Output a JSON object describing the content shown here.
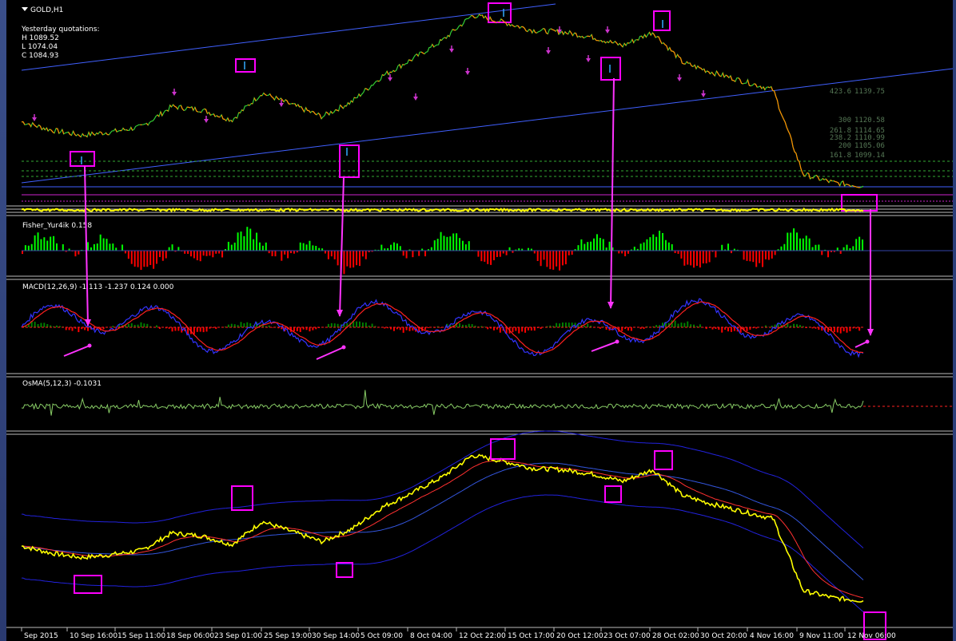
{
  "window": {
    "symbol_label": "GOLD,H1",
    "menu_icon": "triangle-down-icon"
  },
  "quotes": {
    "heading": "Yesterday quotations:",
    "high": "H 1089.52",
    "low": "L 1074.04",
    "close": "C 1084.93"
  },
  "fib_levels": [
    {
      "ratio": "423.6",
      "price": "1139.75"
    },
    {
      "ratio": "300",
      "price": "1120.58"
    },
    {
      "ratio": "261.8",
      "price": "1114.65"
    },
    {
      "ratio": "238.2",
      "price": "1110.99"
    },
    {
      "ratio": "200",
      "price": "1105.06"
    },
    {
      "ratio": "161.8",
      "price": "1099.14"
    }
  ],
  "indicators": {
    "fisher": "Fisher_Yur4ik 0.158",
    "macd": "MACD(12,26,9) -1.113 -1.237 0.124 0.000",
    "osma": "OsMA(5,12,3) -0.1031"
  },
  "colors": {
    "price_bull": "#33cc33",
    "price_bear": "#ff8800",
    "trendline": "#4060ff",
    "box": "#ff00ff",
    "fisher_pos": "#00ff00",
    "fisher_neg": "#ff0000",
    "macd_main": "#3333ff",
    "macd_signal": "#ff2020",
    "macd_hist_pos": "#008000",
    "macd_hist_neg": "#ff0000",
    "bands": "#2222dd",
    "yellow_line": "#ffff00"
  },
  "chart_data": {
    "type": "line",
    "title": "GOLD,H1",
    "x_tick_labels": [
      "Sep 2015",
      "10 Sep 16:00",
      "15 Sep 11:00",
      "18 Sep 06:00",
      "23 Sep 01:00",
      "25 Sep 19:00",
      "30 Sep 14:00",
      "5 Oct 09:00",
      "8 Oct 04:00",
      "12 Oct 22:00",
      "15 Oct 17:00",
      "20 Oct 12:00",
      "23 Oct 07:00",
      "28 Oct 02:00",
      "30 Oct 20:00",
      "4 Nov 16:00",
      "9 Nov 11:00",
      "12 Nov 06:00"
    ],
    "approx_price_path": [
      1121,
      1116,
      1113,
      1115,
      1118,
      1130,
      1128,
      1122,
      1138,
      1131,
      1124,
      1133,
      1148,
      1158,
      1169,
      1184,
      1180,
      1175,
      1174,
      1171,
      1166,
      1174,
      1156,
      1150,
      1145,
      1140,
      1090,
      1085,
      1083
    ],
    "legend": "none",
    "grid": false
  }
}
